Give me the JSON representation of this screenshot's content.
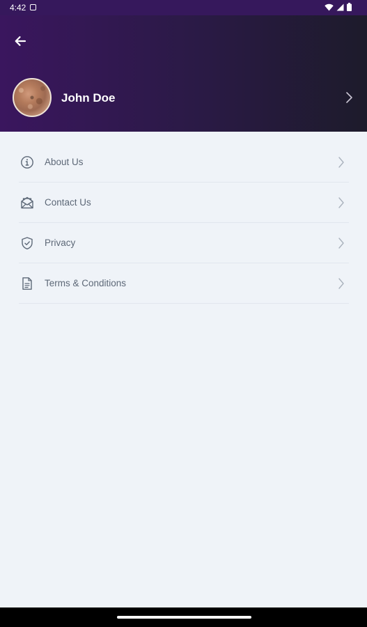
{
  "status_bar": {
    "time": "4:42",
    "icons": [
      "notification-app-icon",
      "wifi-icon",
      "cellular-icon",
      "battery-icon"
    ]
  },
  "header": {
    "back_icon": "arrow-left-icon",
    "profile": {
      "name": "John Doe",
      "avatar": "avatar",
      "chevron_icon": "chevron-right-icon"
    },
    "gradient_colors": [
      "#3a165e",
      "#1d1b2b"
    ]
  },
  "menu": {
    "items": [
      {
        "label": "About Us",
        "icon": "info-circle-icon"
      },
      {
        "label": "Contact Us",
        "icon": "mail-open-icon"
      },
      {
        "label": "Privacy",
        "icon": "shield-check-icon"
      },
      {
        "label": "Terms & Conditions",
        "icon": "document-icon"
      }
    ]
  },
  "colors": {
    "background": "#eff3f8",
    "label": "#5d6877",
    "icon": "#5d6877",
    "chevron": "#aab2bd",
    "divider": "#e1e6ee"
  }
}
